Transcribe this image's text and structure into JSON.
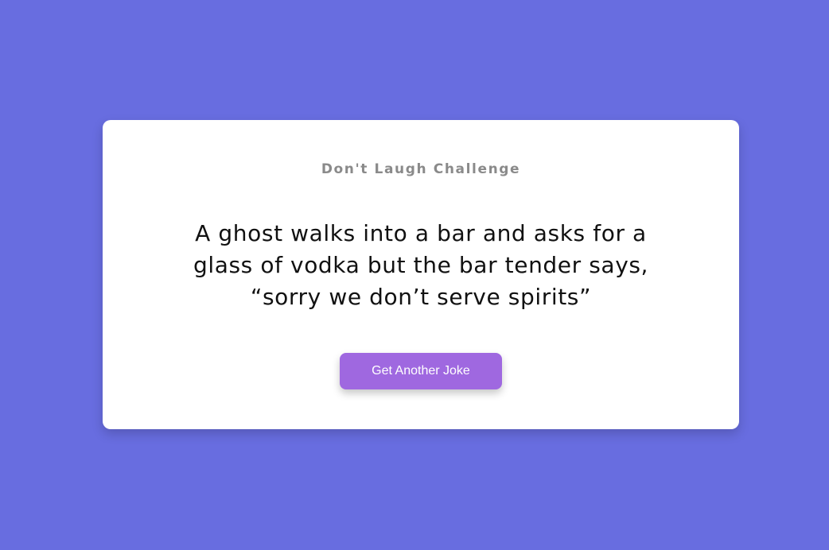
{
  "colors": {
    "background": "#686de0",
    "card": "#ffffff",
    "title": "#8a8a8a",
    "joke_text": "#111111",
    "button": "#9f68e0",
    "button_text": "#ffffff"
  },
  "card": {
    "title": "Don't Laugh Challenge",
    "joke": "A ghost walks into a bar and asks for a glass of vodka but the bar tender says, “sorry we don’t serve spirits”",
    "button_label": "Get Another Joke"
  }
}
